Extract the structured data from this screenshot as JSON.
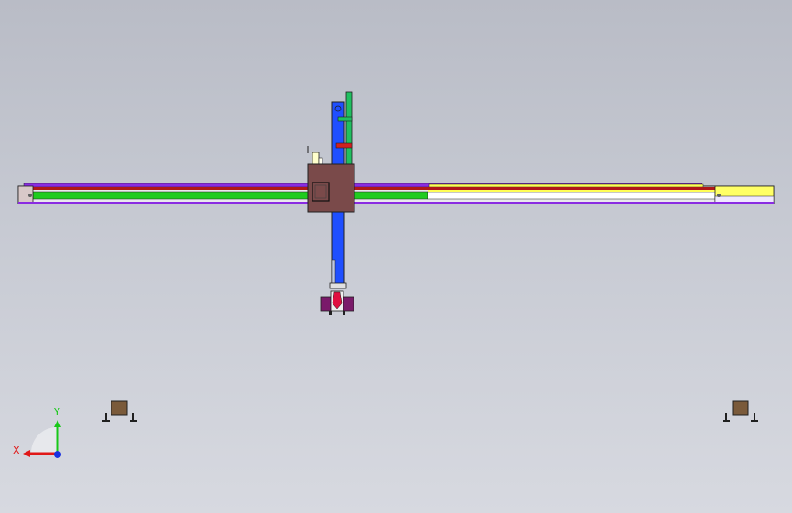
{
  "viewport": {
    "background_top": "#b9bcc6",
    "background_bottom": "#d7d9e0"
  },
  "triad": {
    "x_label": "X",
    "y_label": "Y",
    "x_color": "#e01818",
    "y_color": "#18c818",
    "z_color": "#1830e0"
  },
  "model_colors": {
    "rail_green": "#1fcc1f",
    "rail_purple": "#8a2be2",
    "rail_red": "#b01818",
    "rail_yellow": "#ffff55",
    "carriage_brown": "#7a4a4a",
    "column_blue": "#1f4fff",
    "cylinder_green": "#20c060",
    "gripper_purple": "#7a1a6a",
    "gripper_red": "#e01040",
    "support_brown": "#7a5a3a",
    "outline": "#202020"
  }
}
